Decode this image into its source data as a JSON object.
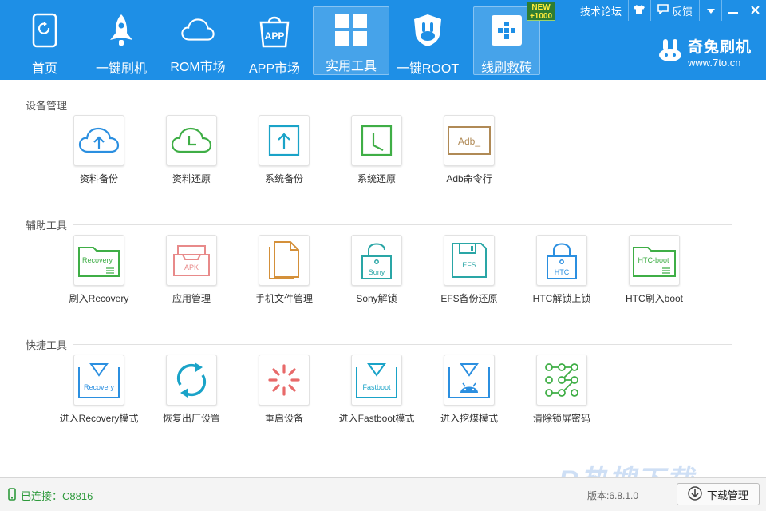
{
  "nav": {
    "items": [
      {
        "label": "首页",
        "icon": "phone-refresh-icon"
      },
      {
        "label": "一键刷机",
        "icon": "rocket-icon"
      },
      {
        "label": "ROM市场",
        "icon": "cloud-icon"
      },
      {
        "label": "APP市场",
        "icon": "app-bag-icon",
        "icon_text": "APP"
      },
      {
        "label": "实用工具",
        "icon": "grid-icon",
        "active": true
      },
      {
        "label": "一键ROOT",
        "icon": "rabbit-shield-icon"
      },
      {
        "label": "线刷救砖",
        "icon": "brick-plus-icon"
      }
    ],
    "new_badge": [
      "NEW",
      "+1000"
    ]
  },
  "topbar": {
    "forum": "技术论坛",
    "feedback": "反馈"
  },
  "brand": {
    "name": "奇兔刷机",
    "url": "www.7to.cn"
  },
  "sections": [
    {
      "title": "设备管理",
      "tools": [
        {
          "label": "资料备份",
          "icon": "cloud-upload-icon",
          "color": "#2b8fe0"
        },
        {
          "label": "资料还原",
          "icon": "cloud-clock-icon",
          "color": "#3fae46"
        },
        {
          "label": "系统备份",
          "icon": "box-upload-icon",
          "color": "#1aa3c8"
        },
        {
          "label": "系统还原",
          "icon": "box-clock-icon",
          "color": "#3fae46"
        },
        {
          "label": "Adb命令行",
          "icon": "terminal-icon",
          "icon_text": "Adb_",
          "color": "#b08a56"
        }
      ]
    },
    {
      "title": "辅助工具",
      "tools": [
        {
          "label": "刷入Recovery",
          "icon": "folder-recovery-icon",
          "icon_text": "Recovery",
          "color": "#3fae46"
        },
        {
          "label": "应用管理",
          "icon": "apk-tray-icon",
          "icon_text": "APK",
          "color": "#e88a8a"
        },
        {
          "label": "手机文件管理",
          "icon": "files-icon",
          "color": "#d4903a"
        },
        {
          "label": "Sony解锁",
          "icon": "lock-sony-icon",
          "icon_text": "Sony",
          "color": "#2aa6a6"
        },
        {
          "label": "EFS备份还原",
          "icon": "floppy-efs-icon",
          "icon_text": "EFS",
          "color": "#2aa6a6"
        },
        {
          "label": "HTC解锁上锁",
          "icon": "lock-htc-icon",
          "icon_text": "HTC",
          "color": "#2b8fe0"
        },
        {
          "label": "HTC刷入boot",
          "icon": "folder-htcboot-icon",
          "icon_text": "HTC-boot",
          "color": "#3fae46"
        }
      ]
    },
    {
      "title": "快捷工具",
      "tools": [
        {
          "label": "进入Recovery模式",
          "icon": "enter-recovery-icon",
          "icon_text": "Recovery",
          "color": "#2b8fe0"
        },
        {
          "label": "恢复出厂设置",
          "icon": "factory-reset-icon",
          "color": "#1aa3c8"
        },
        {
          "label": "重启设备",
          "icon": "reboot-spinner-icon",
          "color": "#e86a6a"
        },
        {
          "label": "进入Fastboot模式",
          "icon": "enter-fastboot-icon",
          "icon_text": "Fastboot",
          "color": "#1aa3c8"
        },
        {
          "label": "进入挖煤模式",
          "icon": "android-download-icon",
          "color": "#2b8fe0"
        },
        {
          "label": "清除锁屏密码",
          "icon": "pattern-lock-icon",
          "color": "#3fae46"
        }
      ]
    }
  ],
  "footer": {
    "status": "已连接：C8816",
    "version": "版本:6.8.1.0",
    "download": "下载管理"
  },
  "watermark": "R热搜下载"
}
